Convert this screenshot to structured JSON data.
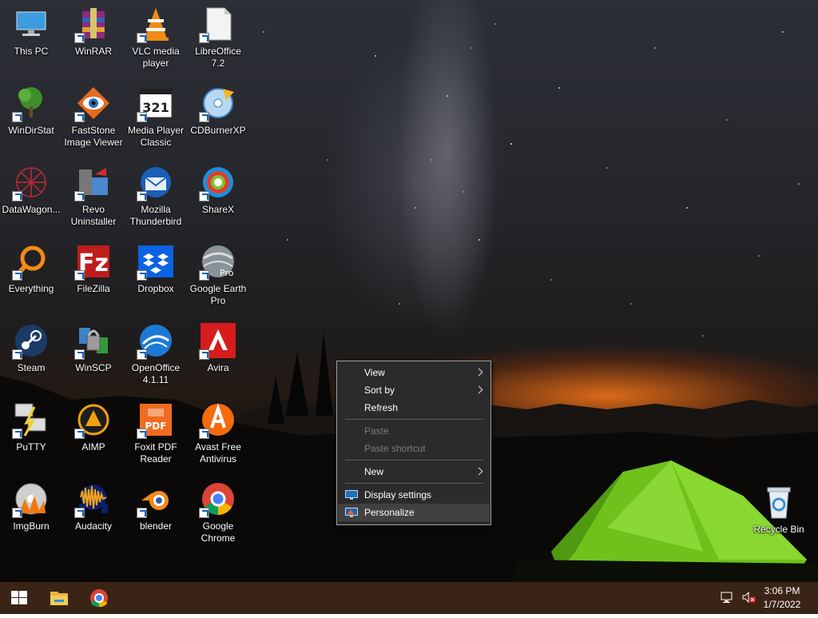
{
  "desktop": {
    "icons": [
      {
        "label": "This PC",
        "icon": "this-pc-icon"
      },
      {
        "label": "WinRAR",
        "icon": "winrar-icon"
      },
      {
        "label": "VLC media\nplayer",
        "icon": "vlc-icon"
      },
      {
        "label": "LibreOffice\n7.2",
        "icon": "libreoffice-icon"
      },
      {
        "label": "WinDirStat",
        "icon": "windirstat-icon"
      },
      {
        "label": "FastStone\nImage Viewer",
        "icon": "faststone-icon"
      },
      {
        "label": "Media Player\nClassic",
        "icon": "media-player-classic-icon"
      },
      {
        "label": "CDBurnerXP",
        "icon": "cdburnerxp-icon"
      },
      {
        "label": "DataWagon...",
        "icon": "datawagon-icon"
      },
      {
        "label": "Revo\nUninstaller",
        "icon": "revo-uninstaller-icon"
      },
      {
        "label": "Mozilla\nThunderbird",
        "icon": "thunderbird-icon"
      },
      {
        "label": "ShareX",
        "icon": "sharex-icon"
      },
      {
        "label": "Everything",
        "icon": "everything-icon"
      },
      {
        "label": "FileZilla",
        "icon": "filezilla-icon"
      },
      {
        "label": "Dropbox",
        "icon": "dropbox-icon"
      },
      {
        "label": "Google Earth\nPro",
        "icon": "google-earth-icon"
      },
      {
        "label": "Steam",
        "icon": "steam-icon"
      },
      {
        "label": "WinSCP",
        "icon": "winscp-icon"
      },
      {
        "label": "OpenOffice\n4.1.11",
        "icon": "openoffice-icon"
      },
      {
        "label": "Avira",
        "icon": "avira-icon"
      },
      {
        "label": "PuTTY",
        "icon": "putty-icon"
      },
      {
        "label": "AIMP",
        "icon": "aimp-icon"
      },
      {
        "label": "Foxit PDF\nReader",
        "icon": "foxit-icon"
      },
      {
        "label": "Avast Free\nAntivirus",
        "icon": "avast-icon"
      },
      {
        "label": "ImgBurn",
        "icon": "imgburn-icon"
      },
      {
        "label": "Audacity",
        "icon": "audacity-icon"
      },
      {
        "label": "blender",
        "icon": "blender-icon"
      },
      {
        "label": "Google\nChrome",
        "icon": "chrome-icon"
      }
    ],
    "recycle_bin": {
      "label": "Recycle Bin",
      "icon": "recycle-bin-icon"
    }
  },
  "context_menu": {
    "items": {
      "view": {
        "label": "View",
        "has_submenu": true
      },
      "sort_by": {
        "label": "Sort by",
        "has_submenu": true
      },
      "refresh": {
        "label": "Refresh"
      },
      "paste": {
        "label": "Paste",
        "disabled": true
      },
      "paste_shortcut": {
        "label": "Paste shortcut",
        "disabled": true
      },
      "new": {
        "label": "New",
        "has_submenu": true
      },
      "display_settings": {
        "label": "Display settings",
        "icon": "display-icon"
      },
      "personalize": {
        "label": "Personalize",
        "icon": "personalize-icon",
        "highlighted": true
      }
    }
  },
  "taskbar": {
    "start_icon": "windows-logo-icon",
    "pinned": [
      "file-explorer-icon",
      "chrome-icon"
    ],
    "tray": {
      "network_icon": "network-icon",
      "volume_icon": "volume-muted-icon"
    },
    "clock": {
      "time": "3:06 PM",
      "date": "1/7/2022"
    }
  },
  "colors": {
    "taskbar": "#3a2416",
    "menu_bg": "#2b2b2b",
    "menu_highlight": "#414141"
  }
}
